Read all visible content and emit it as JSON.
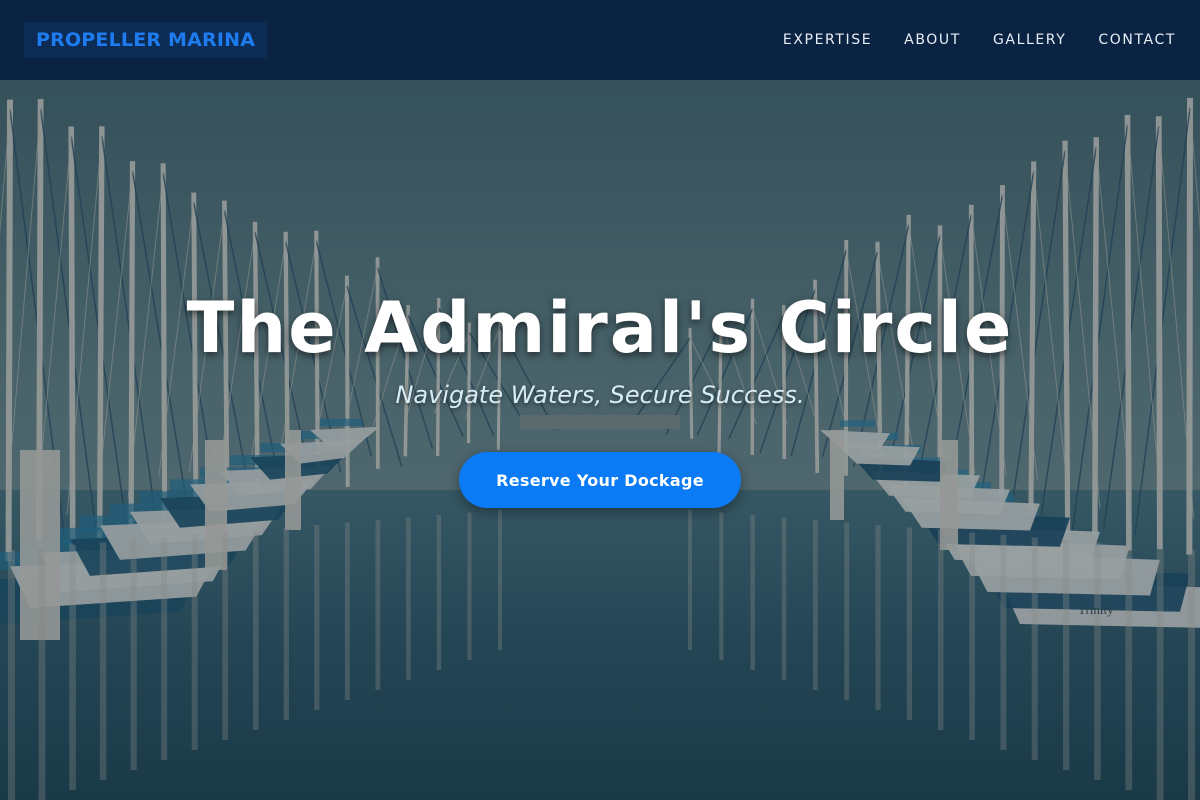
{
  "brand": {
    "logo_text": "PROPELLER MARINA"
  },
  "nav": {
    "items": [
      {
        "label": "EXPERTISE"
      },
      {
        "label": "ABOUT"
      },
      {
        "label": "GALLERY"
      },
      {
        "label": "CONTACT"
      }
    ]
  },
  "hero": {
    "title": "The Admiral's Circle",
    "subtitle": "Navigate Waters, Secure Success.",
    "cta_label": "Reserve Your Dockage",
    "boat_name": "Trinity"
  },
  "colors": {
    "header_bg": "#0a2342",
    "logo_text": "#1e7cf0",
    "nav_text": "#e8eef6",
    "cta_bg": "#0a7af5",
    "hero_title": "#ffffff",
    "hero_subtitle": "#d8ecf6"
  }
}
